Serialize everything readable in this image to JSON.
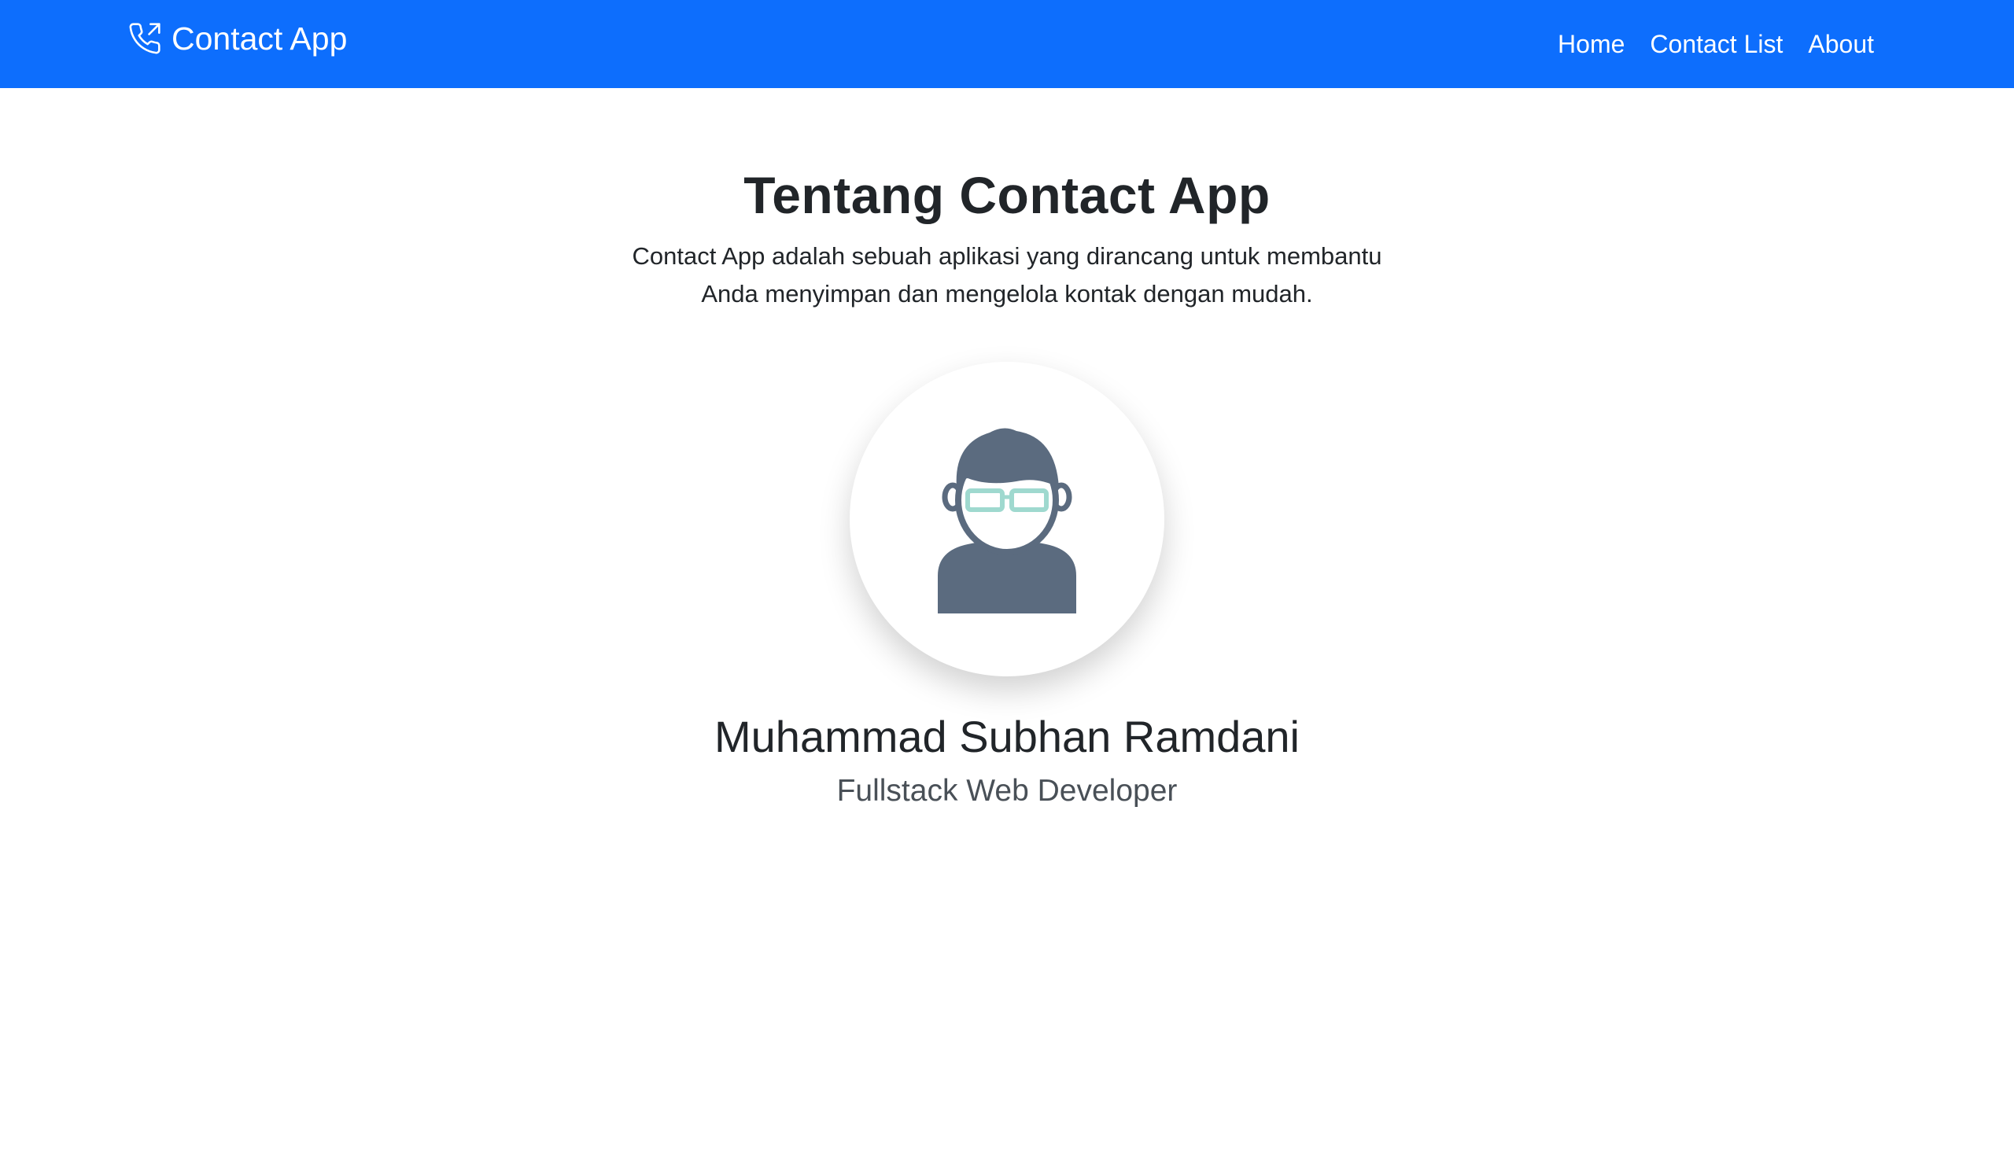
{
  "navbar": {
    "brand_label": "Contact App",
    "brand_icon": "phone-outgoing-icon",
    "links": [
      {
        "label": "Home"
      },
      {
        "label": "Contact List"
      },
      {
        "label": "About"
      }
    ]
  },
  "about": {
    "title": "Tentang Contact App",
    "description": "Contact App adalah sebuah aplikasi yang dirancang untuk membantu Anda menyimpan dan mengelola kontak dengan mudah.",
    "avatar_icon": "user-with-glasses-avatar",
    "name": "Muhammad Subhan Ramdani",
    "role": "Fullstack Web Developer"
  },
  "colors": {
    "navbar_bg": "#0d6efd",
    "avatar_primary": "#5b6b7f",
    "avatar_accent": "#9fd9cf"
  }
}
